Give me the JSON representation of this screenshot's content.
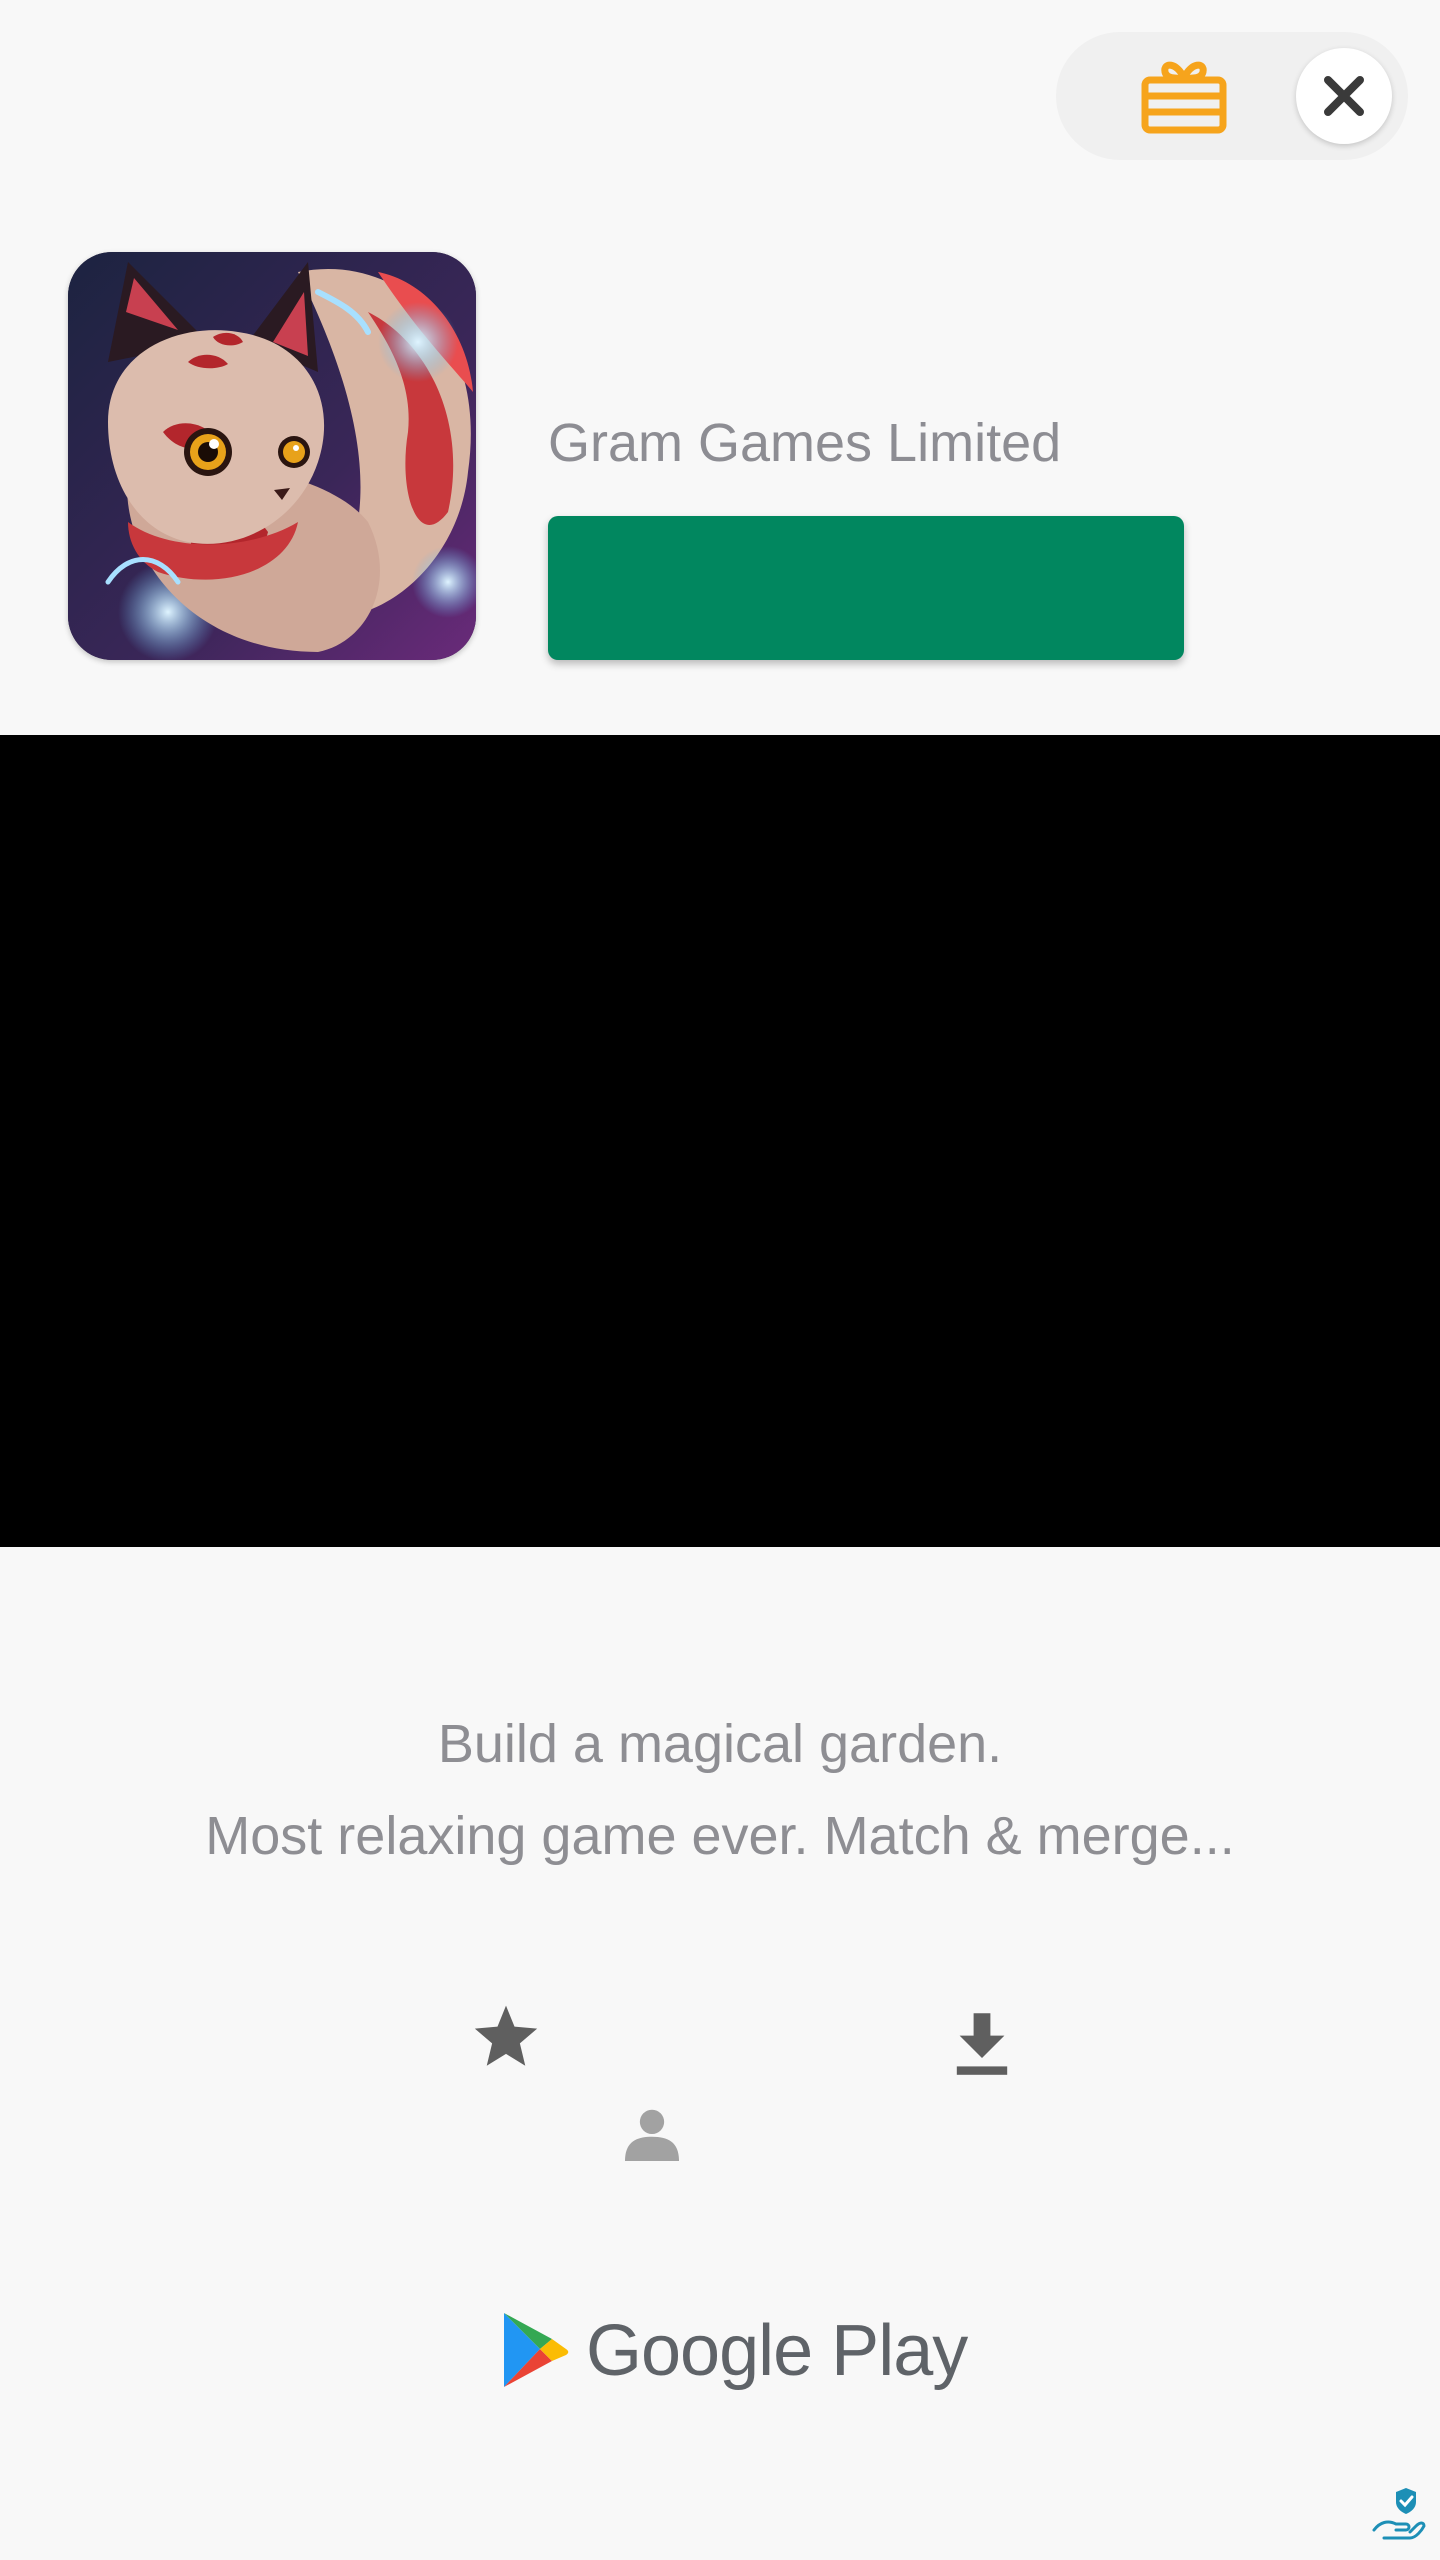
{
  "header": {
    "gift_icon": "gift-icon",
    "close_icon": "close-icon",
    "accent_color": "#f6a41c"
  },
  "app": {
    "developer": "Gram Games Limited",
    "install_label": "",
    "install_color": "#01875f"
  },
  "description": {
    "line1": "Build a magical garden.",
    "line2": "Most relaxing game ever. Match & merge..."
  },
  "stats": {
    "rating_icon": "star-icon",
    "rating_value": "",
    "downloads_icon": "download-icon",
    "downloads_value": "",
    "reviews_icon": "person-icon",
    "reviews_value": ""
  },
  "store": {
    "name": "Google Play"
  },
  "footer": {
    "privacy_icon": "privacy-hand-shield-icon"
  }
}
